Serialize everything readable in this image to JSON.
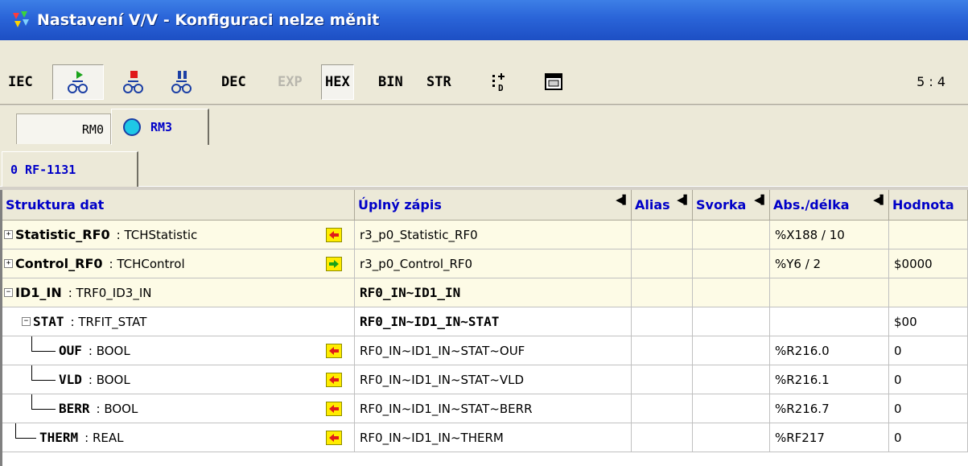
{
  "window": {
    "title": "Nastavení V/V - Konfiguraci nelze měnit"
  },
  "toolbar": {
    "iec_label": "IEC",
    "dec_label": "DEC",
    "exp_label": "EXP",
    "hex_label": "HEX",
    "bin_label": "BIN",
    "str_label": "STR",
    "coords": "5 : 4"
  },
  "module_tabs": {
    "rm0": "RM0",
    "rm3": "RM3"
  },
  "device_tabs": {
    "rf1131": "0 RF-1131"
  },
  "columns": {
    "struktura": "Struktura dat",
    "zapis": "Úplný zápis",
    "alias": "Alias",
    "svorka": "Svorka",
    "abs": "Abs./délka",
    "hodnota": "Hodnota"
  },
  "rows": [
    {
      "name": "Statistic_RF0",
      "type": ": TCHStatistic",
      "zapis": "r3_p0_Statistic_RF0",
      "abs": "%X188 / 10",
      "hodnota": ""
    },
    {
      "name": "Control_RF0",
      "type": ": TCHControl",
      "zapis": "r3_p0_Control_RF0",
      "abs": "%Y6 / 2",
      "hodnota": "$0000"
    },
    {
      "name": "ID1_IN",
      "type": ": TRF0_ID3_IN",
      "zapis": "RF0_IN~ID1_IN",
      "abs": "",
      "hodnota": ""
    },
    {
      "name": "STAT",
      "type": ": TRFIT_STAT",
      "zapis": "RF0_IN~ID1_IN~STAT",
      "abs": "",
      "hodnota": "$00"
    },
    {
      "name": "OUF",
      "type": ": BOOL",
      "zapis": "RF0_IN~ID1_IN~STAT~OUF",
      "abs": "%R216.0",
      "hodnota": "0"
    },
    {
      "name": "VLD",
      "type": ": BOOL",
      "zapis": "RF0_IN~ID1_IN~STAT~VLD",
      "abs": "%R216.1",
      "hodnota": "0"
    },
    {
      "name": "BERR",
      "type": ": BOOL",
      "zapis": "RF0_IN~ID1_IN~STAT~BERR",
      "abs": "%R216.7",
      "hodnota": "0"
    },
    {
      "name": "THERM",
      "type": ": REAL",
      "zapis": "RF0_IN~ID1_IN~THERM",
      "abs": "%RF217",
      "hodnota": "0"
    }
  ]
}
